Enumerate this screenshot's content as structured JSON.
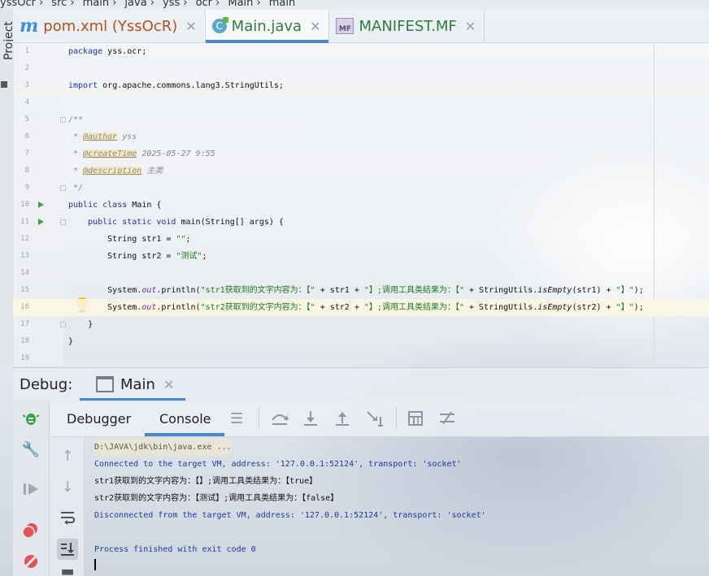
{
  "breadcrumb": [
    "yssOcr",
    "src",
    "main",
    "java",
    "yss",
    "ocr",
    "Main",
    "main"
  ],
  "project_label": "Project",
  "tabs": [
    {
      "label": "pom.xml (YssOcR)",
      "icon": "maven-icon",
      "active": false
    },
    {
      "label": "Main.java",
      "icon": "java-class-icon",
      "active": true
    },
    {
      "label": "MANIFEST.MF",
      "icon": "manifest-icon",
      "active": false
    }
  ],
  "editor": {
    "lines": [
      {
        "n": "1",
        "seg": [
          {
            "t": "package ",
            "c": "kw"
          },
          {
            "t": "yss.ocr;",
            "c": ""
          }
        ]
      },
      {
        "n": "2",
        "seg": []
      },
      {
        "n": "3",
        "seg": [
          {
            "t": "import ",
            "c": "kw"
          },
          {
            "t": "org.apache.commons.lang3.StringUtils;",
            "c": ""
          }
        ]
      },
      {
        "n": "4",
        "seg": []
      },
      {
        "n": "5",
        "seg": [
          {
            "t": "/**",
            "c": "cmt"
          }
        ],
        "fold": true
      },
      {
        "n": "6",
        "seg": [
          {
            "t": " * ",
            "c": "cmt"
          },
          {
            "t": "@author",
            "c": "tag"
          },
          {
            "t": " yss",
            "c": "cmt"
          }
        ]
      },
      {
        "n": "7",
        "seg": [
          {
            "t": " * ",
            "c": "cmt"
          },
          {
            "t": "@createTime",
            "c": "tag"
          },
          {
            "t": " 2025-05-27 9:55",
            "c": "cmt"
          }
        ]
      },
      {
        "n": "8",
        "seg": [
          {
            "t": " * ",
            "c": "cmt"
          },
          {
            "t": "@description",
            "c": "tag"
          },
          {
            "t": " 主类",
            "c": "cmt"
          }
        ]
      },
      {
        "n": "9",
        "seg": [
          {
            "t": " */",
            "c": "cmt"
          }
        ],
        "fold": true
      },
      {
        "n": "10",
        "seg": [
          {
            "t": "public class ",
            "c": "kw"
          },
          {
            "t": "Main {",
            "c": ""
          }
        ],
        "run": true
      },
      {
        "n": "11",
        "seg": [
          {
            "t": "    public static void ",
            "c": "kw"
          },
          {
            "t": "main(String[] args) {",
            "c": ""
          }
        ],
        "run": true,
        "fold": true
      },
      {
        "n": "12",
        "seg": [
          {
            "t": "        String str1 = ",
            "c": ""
          },
          {
            "t": "\"\"",
            "c": "str"
          },
          {
            "t": ";",
            "c": ""
          }
        ]
      },
      {
        "n": "13",
        "seg": [
          {
            "t": "        String str2 = ",
            "c": ""
          },
          {
            "t": "\"测试\"",
            "c": "str"
          },
          {
            "t": ";",
            "c": ""
          }
        ]
      },
      {
        "n": "14",
        "seg": []
      },
      {
        "n": "15",
        "seg": [
          {
            "t": "        System.",
            "c": ""
          },
          {
            "t": "out",
            "c": "field"
          },
          {
            "t": ".println(",
            "c": ""
          },
          {
            "t": "\"str1获取到的文字内容为：【\"",
            "c": "str"
          },
          {
            "t": " + str1 + ",
            "c": ""
          },
          {
            "t": "\"】;调用工具类结果为：【\"",
            "c": "str"
          },
          {
            "t": " + StringUtils.",
            "c": ""
          },
          {
            "t": "isEmpty",
            "c": "static"
          },
          {
            "t": "(str1) + ",
            "c": ""
          },
          {
            "t": "\"】\"",
            "c": "str"
          },
          {
            "t": ");",
            "c": ""
          }
        ]
      },
      {
        "n": "16",
        "seg": [
          {
            "t": "        System.",
            "c": ""
          },
          {
            "t": "out",
            "c": "field"
          },
          {
            "t": ".println(",
            "c": ""
          },
          {
            "t": "\"str2获取到的文字内容为：【\"",
            "c": "str"
          },
          {
            "t": " + str2 + ",
            "c": ""
          },
          {
            "t": "\"】;调用工具类结果为：【\"",
            "c": "str"
          },
          {
            "t": " + StringUtils.",
            "c": ""
          },
          {
            "t": "isEmpty",
            "c": "static"
          },
          {
            "t": "(str2) + ",
            "c": ""
          },
          {
            "t": "\"】\"",
            "c": "str"
          },
          {
            "t": ");",
            "c": ""
          }
        ],
        "current": true
      },
      {
        "n": "17",
        "seg": [
          {
            "t": "    }",
            "c": ""
          }
        ],
        "fold": true
      },
      {
        "n": "18",
        "seg": [
          {
            "t": "}",
            "c": ""
          }
        ]
      },
      {
        "n": "19",
        "seg": []
      }
    ]
  },
  "debug": {
    "title": "Debug:",
    "session_tab": "Main",
    "subtabs": {
      "debugger": "Debugger",
      "console": "Console"
    },
    "console_lines": [
      {
        "text": "D:\\JAVA\\jdk\\bin\\java.exe ...",
        "kind": "cmd"
      },
      {
        "text": "Connected to the target VM, address: '127.0.0.1:52124', transport: 'socket'",
        "kind": "sys"
      },
      {
        "text": "str1获取到的文字内容为：【】;调用工具类结果为：【true】",
        "kind": "out"
      },
      {
        "text": "str2获取到的文字内容为：【测试】;调用工具类结果为：【false】",
        "kind": "out"
      },
      {
        "text": "Disconnected from the target VM, address: '127.0.0.1:52124', transport: 'socket'",
        "kind": "sys"
      },
      {
        "text": "",
        "kind": "out"
      },
      {
        "text": "Process finished with exit code 0",
        "kind": "sys"
      }
    ]
  },
  "colors": {
    "accent": "#4a88c7",
    "keyword": "#1a33a6",
    "string": "#1d7a1d",
    "run": "#3ca24a"
  }
}
